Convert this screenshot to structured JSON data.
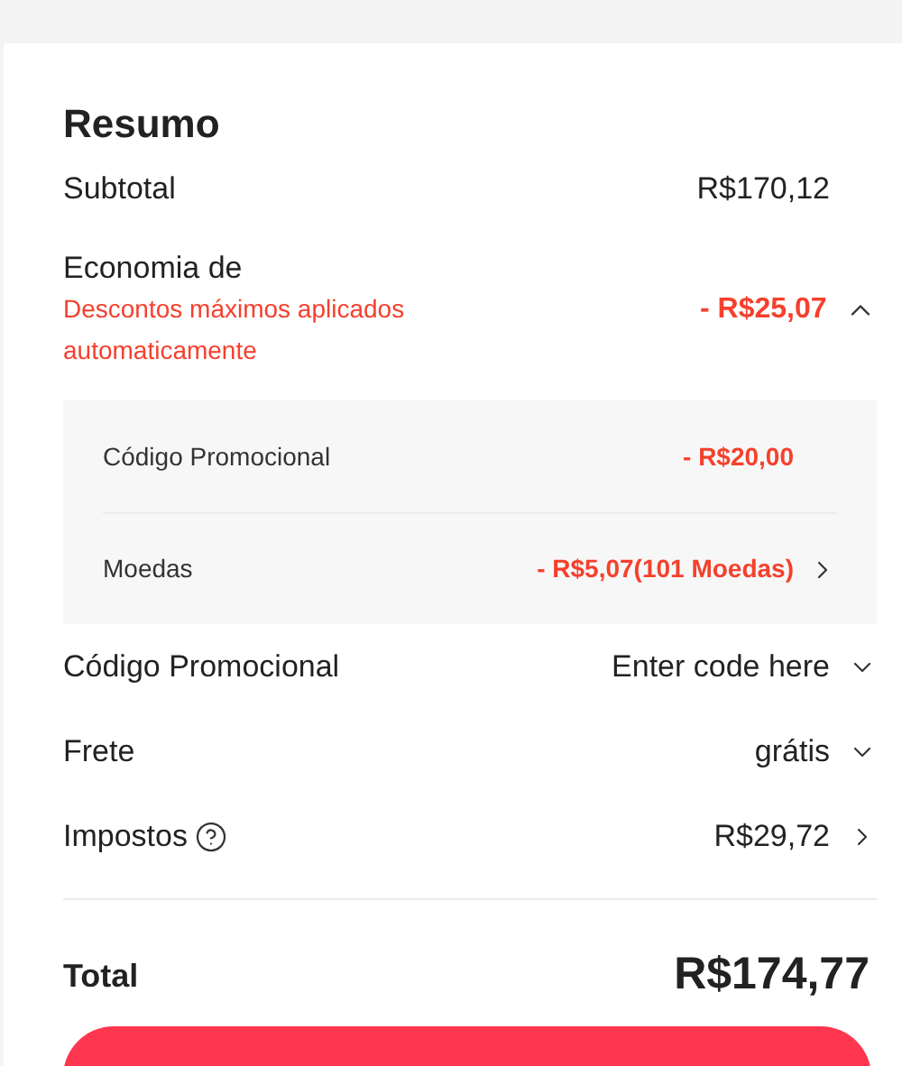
{
  "title": "Resumo",
  "subtotal": {
    "label": "Subtotal",
    "value": "R$170,12"
  },
  "savings": {
    "label": "Economia de",
    "note": "Descontos máximos aplicados automaticamente",
    "value": "- R$25,07",
    "expanded": true,
    "items": [
      {
        "label": "Código Promocional",
        "value": "- R$20,00",
        "link": false
      },
      {
        "label": "Moedas",
        "value": "- R$5,07(101 Moedas)",
        "link": true
      }
    ]
  },
  "rows": [
    {
      "label": "Código Promocional",
      "value": "Enter code here",
      "kind": "dropdown",
      "help": false
    },
    {
      "label": "Frete",
      "value": "grátis",
      "kind": "dropdown",
      "help": false
    },
    {
      "label": "Impostos",
      "value": "R$29,72",
      "kind": "link",
      "help": true
    }
  ],
  "total": {
    "label": "Total",
    "value": "R$174,77"
  }
}
